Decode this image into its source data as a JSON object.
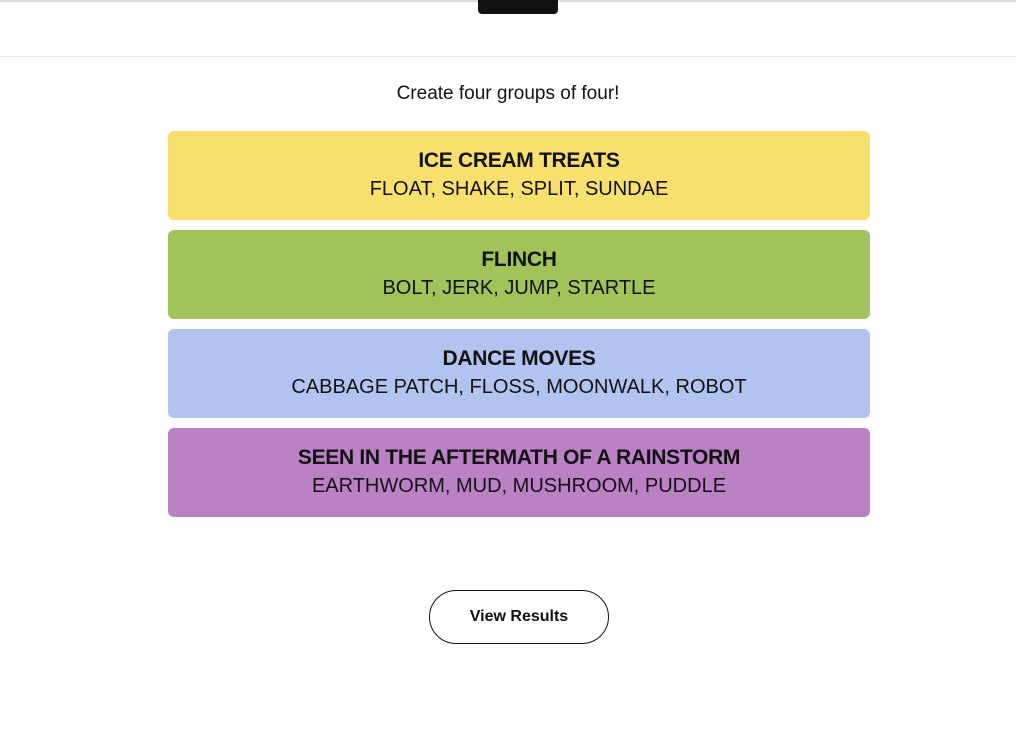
{
  "header": {
    "instructions": "Create four groups of four!"
  },
  "groups": [
    {
      "title": "ICE CREAM TREATS",
      "members": "FLOAT, SHAKE, SPLIT, SUNDAE",
      "color": "#F9DF6D"
    },
    {
      "title": "FLINCH",
      "members": "BOLT, JERK, JUMP, STARTLE",
      "color": "#A0C35A"
    },
    {
      "title": "DANCE MOVES",
      "members": "CABBAGE PATCH, FLOSS, MOONWALK, ROBOT",
      "color": "#B0C4EF"
    },
    {
      "title": "SEEN IN THE AFTERMATH OF A RAINSTORM",
      "members": "EARTHWORM, MUD, MUSHROOM, PUDDLE",
      "color": "#BA81C5"
    }
  ],
  "actions": {
    "view_results_label": "View Results"
  }
}
